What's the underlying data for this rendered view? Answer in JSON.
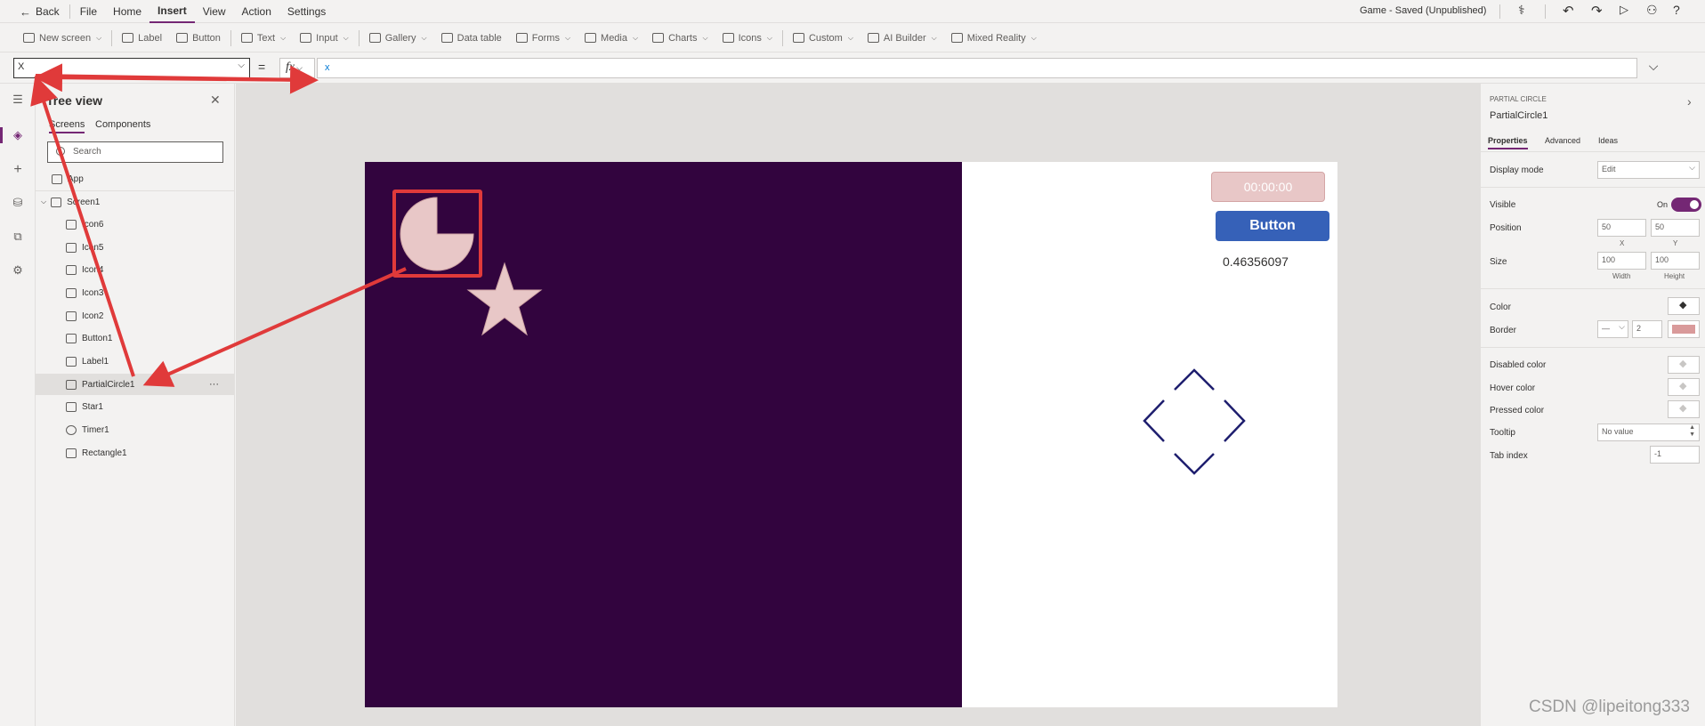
{
  "topbar": {
    "back_label": "Back",
    "menu": [
      "File",
      "Home",
      "Insert",
      "View",
      "Action",
      "Settings"
    ],
    "active_menu": "Insert",
    "status": "Game - Saved (Unpublished)"
  },
  "ribbon": {
    "items": [
      {
        "label": "New screen",
        "icon": "new-screen-icon"
      },
      {
        "label": "Label",
        "icon": "label-icon"
      },
      {
        "label": "Button",
        "icon": "button-icon"
      },
      {
        "label": "Text",
        "icon": "text-icon"
      },
      {
        "label": "Input",
        "icon": "input-icon"
      },
      {
        "label": "Gallery",
        "icon": "gallery-icon"
      },
      {
        "label": "Data table",
        "icon": "data-table-icon"
      },
      {
        "label": "Forms",
        "icon": "forms-icon"
      },
      {
        "label": "Media",
        "icon": "media-icon"
      },
      {
        "label": "Charts",
        "icon": "charts-icon"
      },
      {
        "label": "Icons",
        "icon": "icons-icon"
      },
      {
        "label": "Custom",
        "icon": "custom-icon"
      },
      {
        "label": "AI Builder",
        "icon": "ai-builder-icon"
      },
      {
        "label": "Mixed Reality",
        "icon": "mixed-reality-icon"
      }
    ]
  },
  "formula": {
    "property": "X",
    "equals": "=",
    "fx": "fx",
    "value": "x"
  },
  "tree": {
    "title": "Tree view",
    "tabs": [
      "Screens",
      "Components"
    ],
    "search_placeholder": "Search",
    "app_label": "App",
    "screen_label": "Screen1",
    "items": [
      "Icon6",
      "Icon5",
      "Icon4",
      "Icon3",
      "Icon2",
      "Button1",
      "Label1",
      "PartialCircle1",
      "Star1",
      "Timer1",
      "Rectangle1"
    ],
    "selected": "PartialCircle1",
    "more": "···"
  },
  "canvas": {
    "timer_text": "00:00:00",
    "button_text": "Button",
    "label_text": "0.46356097"
  },
  "properties": {
    "control_type": "PARTIAL CIRCLE",
    "control_name": "PartialCircle1",
    "tabs": [
      "Properties",
      "Advanced",
      "Ideas"
    ],
    "display_mode_label": "Display mode",
    "display_mode_value": "Edit",
    "visible_label": "Visible",
    "visible_value": "On",
    "position_label": "Position",
    "position_x": "50",
    "position_y": "50",
    "x_label": "X",
    "y_label": "Y",
    "size_label": "Size",
    "width": "100",
    "height": "100",
    "width_label": "Width",
    "height_label": "Height",
    "color_label": "Color",
    "border_label": "Border",
    "border_width": "2",
    "disabled_color_label": "Disabled color",
    "hover_color_label": "Hover color",
    "pressed_color_label": "Pressed color",
    "tooltip_label": "Tooltip",
    "tooltip_value": "No value",
    "tab_index_label": "Tab index",
    "tab_index_value": "-1"
  },
  "colors": {
    "accent": "#742774",
    "dark_screen": "#32043e",
    "shape_fill": "#e8c7c7",
    "button_blue": "#3661b8",
    "annotation_red": "#e03a3a"
  },
  "watermark": "CSDN @lipeitong333"
}
